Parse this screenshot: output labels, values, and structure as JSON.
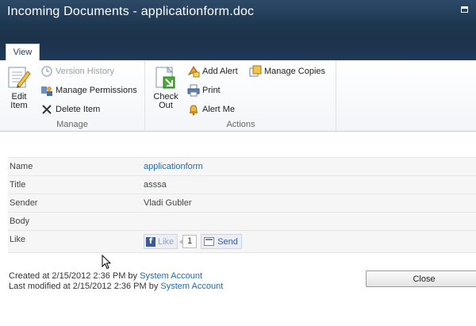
{
  "window": {
    "title": "Incoming Documents - applicationform.doc"
  },
  "tabs": [
    {
      "label": "View"
    }
  ],
  "ribbon": {
    "manage": {
      "label": "Manage",
      "edit_item": {
        "line1": "Edit",
        "line2": "Item"
      },
      "version_history": "Version History",
      "manage_permissions": "Manage Permissions",
      "delete_item": "Delete Item"
    },
    "actions": {
      "label": "Actions",
      "check_out": {
        "line1": "Check",
        "line2": "Out"
      },
      "add_alert": "Add Alert",
      "manage_copies": "Manage Copies",
      "print": "Print",
      "alert_me": "Alert Me"
    }
  },
  "fields": [
    {
      "label": "Name",
      "value": "applicationform"
    },
    {
      "label": "Title",
      "value": "asssa"
    },
    {
      "label": "Sender",
      "value": "Vladi Gubler"
    },
    {
      "label": "Body",
      "value": ""
    },
    {
      "label": "Like",
      "like_label": "Like",
      "like_count": "1",
      "send_label": "Send"
    }
  ],
  "footer": {
    "created_prefix": "Created at 2/15/2012 2:36 PM  by",
    "created_by": "System Account",
    "modified_prefix": "Last modified at 2/15/2012 2:36 PM  by",
    "modified_by": "System Account"
  },
  "buttons": {
    "close": "Close"
  },
  "colors": {
    "title_bar": "#1f3852",
    "link": "#1f6ab2",
    "facebook": "#3b5998"
  }
}
